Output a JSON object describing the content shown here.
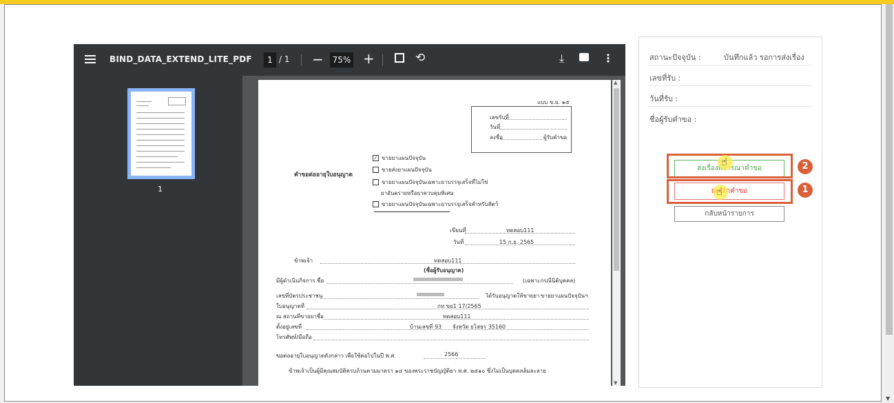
{
  "viewer": {
    "file_name": "BIND_DATA_EXTEND_LITE_PDF",
    "current_page": "1",
    "total_pages": "/ 1",
    "zoom": "75%",
    "thumbnail_label": "1",
    "icons": [
      "menu-icon",
      "zoom-out-icon",
      "zoom-in-icon",
      "fit-page-icon",
      "rotate-icon",
      "download-icon",
      "print-icon",
      "more-icon"
    ]
  },
  "document": {
    "form_code": "แบบ ข.ย. ๑๕",
    "receipt_box": {
      "number_label": "เลขรับที่",
      "date_label": "วันที่",
      "sign_label": "ลงชื่อ",
      "receiver_label": "ผู้รับคำขอ"
    },
    "form_title": "คำขอต่ออายุใบอนุญาต",
    "options": [
      {
        "checked": true,
        "text": "ขายยาแผนปัจจุบัน"
      },
      {
        "checked": false,
        "text": "ขายส่งยาแผนปัจจุบัน"
      },
      {
        "checked": false,
        "text": "ขายยาแผนปัจจุบันเฉพาะยาบรรจุเสร็จที่ไม่ใช่"
      },
      {
        "checked": false,
        "text": "ขายยาแผนปัจจุบันเฉพาะยาบรรจุเสร็จสำหรับสัตว์"
      }
    ],
    "option3_cont": "ยาอันตรายหรือยาควบคุมพิเศษ",
    "written_at_label": "เขียนที่",
    "written_at": "ทดสอบ111",
    "date_label": "วันที่",
    "date": "15 ก.ย. 2565",
    "i_label": "ข้าพเจ้า",
    "i_value": "ทดสอบ111",
    "licensee_caption": "(ชื่อผู้รับอนุญาต)",
    "operator_label": "มีผู้ดำเนินกิจการ ชื่อ",
    "juristic_note": "(เฉพาะกรณีนิติบุคคล)",
    "id_label": "เลขที่บัตรประชาชน",
    "licensed_label": "ได้รับอนุญาตให้ขายยา",
    "licensed_value": "ขายยาแผนปัจจุบันฯ",
    "license_no_label": "ใบอนุญาตที่",
    "license_no": "กท ขย1 17/2565",
    "place_label": "ณ สถานที่ขายยาชื่อ",
    "place_value": "ทดสอบ111",
    "located_label": "ตั้งอยู่เลขที่",
    "house_no": "บ้านเลขที่ 93",
    "province": "จังหวัด ยโสธร 35160",
    "phone_label": "โทรศัพท์/มือถือ",
    "renew_label": "ขอต่ออายุใบอนุญาตดังกล่าว เพื่อใช้ต่อไปในปี พ.ศ.",
    "renew_year": "2566",
    "last_line": "ข้าพเจ้าเป็นผู้มีคุณสมบัติครบถ้วนตามมาตรา ๑๔ ของพระราชบัญญัติยา พ.ศ. ๒๕๑๐ ซึ่งไม่เป็นบุคคลล้มละลาย"
  },
  "status_panel": {
    "current_status_label": "สถานะปัจจุบัน :",
    "current_status_value": "บันทึกแล้ว รอการส่งเรื่อง",
    "receive_no_label": "เลขที่รับ :",
    "receive_date_label": "วันที่รับ :",
    "receiver_label": "ชื่อผู้รับคำขอ :"
  },
  "actions": {
    "send_label": "ส่งเรื่องพิจารณาคำขอ",
    "cancel_label": "ยกเลิกคำขอ",
    "back_label": "กลับหน้ารายการ",
    "step1": "1",
    "step2": "2"
  },
  "colors": {
    "accent": "#f5cc1d",
    "highlight": "#d9603b",
    "send": "#4cae4c",
    "cancel": "#e53935",
    "thumb_border": "#8ab4f8"
  }
}
